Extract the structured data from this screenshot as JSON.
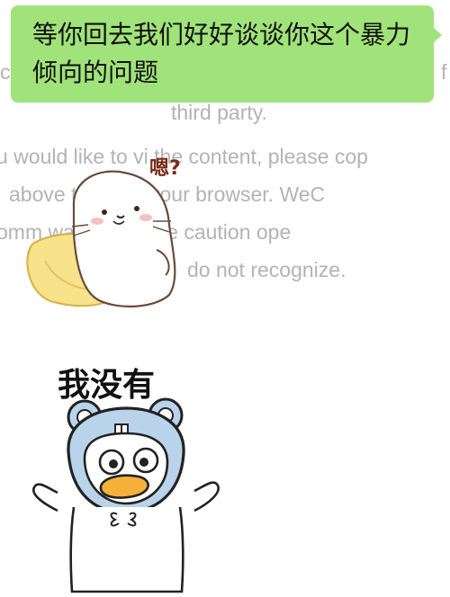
{
  "chat": {
    "bubble_text": "等你回去我们好好谈谈你这个暴力倾向的问题",
    "bubble_color": "#a0e37a"
  },
  "background_notice": {
    "line1_left": "c",
    "line1_right": "f",
    "line2": "third party.",
    "line3": "u would like to vi   the content, please cop",
    "line4": "above           te it into your browser. WeC",
    "line5": "omm          ways exercise caution ope",
    "line6": "do not recognize."
  },
  "stickers": {
    "seal": {
      "caption": "嗯?"
    },
    "bear_hood_duck": {
      "caption": "我没有"
    }
  }
}
